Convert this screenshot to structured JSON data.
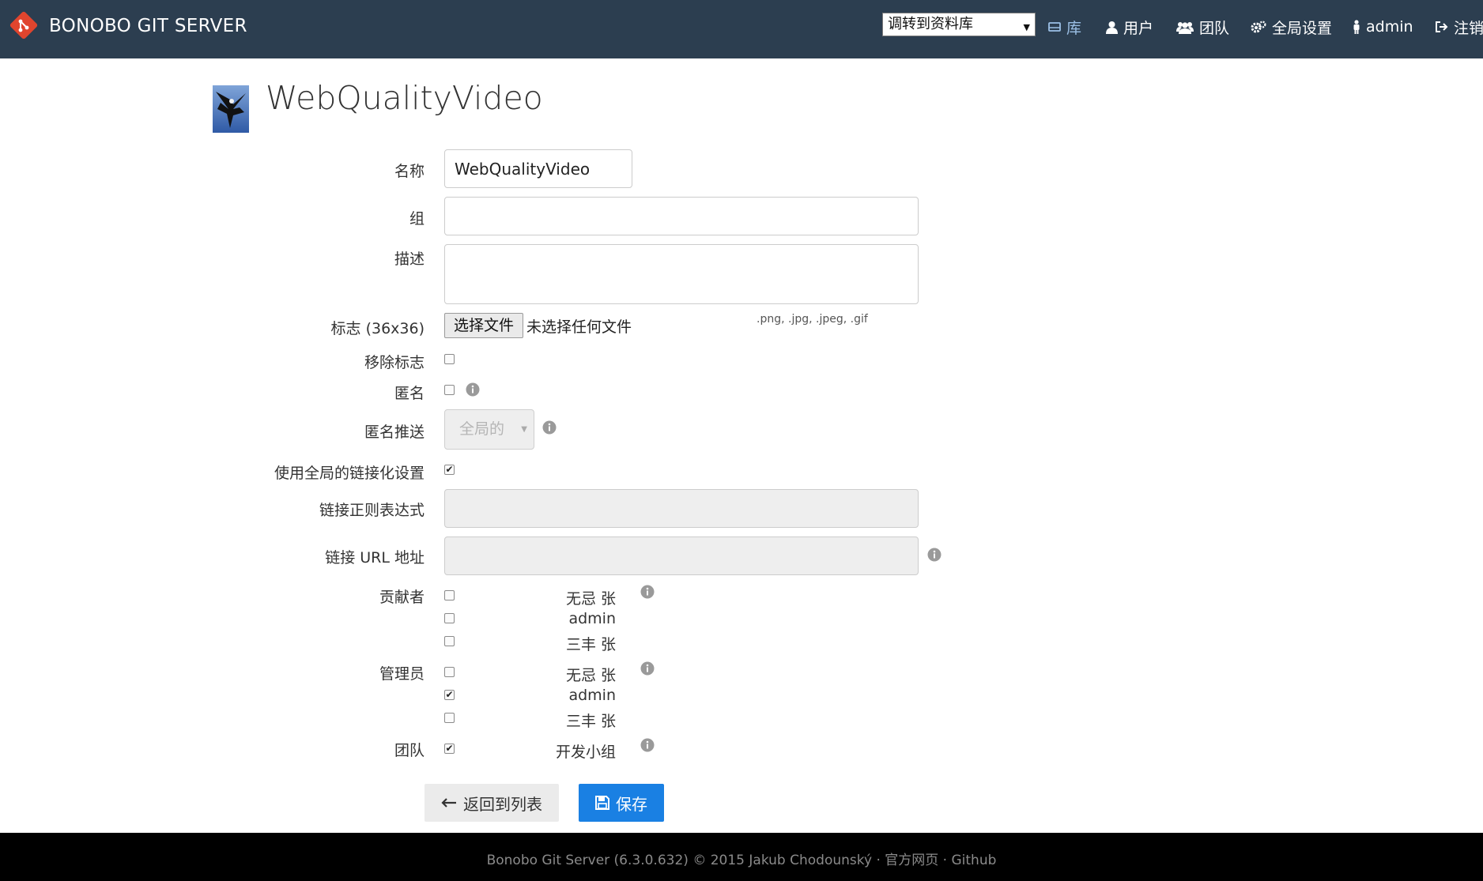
{
  "navbar": {
    "brand": "BONOBO GIT SERVER",
    "repo_jump": "调转到资料库",
    "items": [
      {
        "label": "库",
        "icon": "repository-icon",
        "active": true
      },
      {
        "label": "用户",
        "icon": "user-icon"
      },
      {
        "label": "团队",
        "icon": "team-icon"
      },
      {
        "label": "全局设置",
        "icon": "gears-icon"
      },
      {
        "label": "admin",
        "icon": "person-icon"
      },
      {
        "label": "注销",
        "icon": "logout-icon"
      }
    ]
  },
  "page": {
    "title": "WebQualityVideo"
  },
  "form": {
    "name_label": "名称",
    "name_value": "WebQualityVideo",
    "group_label": "组",
    "group_value": "",
    "description_label": "描述",
    "description_value": "",
    "logo_label": "标志 (36x36)",
    "choose_file": "选择文件",
    "no_file": "未选择任何文件",
    "file_types": ".png, .jpg, .jpeg, .gif",
    "remove_logo_label": "移除标志",
    "remove_logo_checked": false,
    "anonymous_label": "匿名",
    "anonymous_checked": false,
    "anonymous_push_label": "匿名推送",
    "anonymous_push_value": "全局的",
    "global_linkify_label": "使用全局的链接化设置",
    "global_linkify_checked": true,
    "link_regex_label": "链接正则表达式",
    "link_regex_value": "",
    "link_url_label": "链接 URL 地址",
    "link_url_value": "",
    "contributors_label": "贡献者",
    "contributors": [
      {
        "name": "无忌 张",
        "checked": false
      },
      {
        "name": "admin",
        "checked": false
      },
      {
        "name": "三丰 张",
        "checked": false
      }
    ],
    "administrators_label": "管理员",
    "administrators": [
      {
        "name": "无忌 张",
        "checked": false
      },
      {
        "name": "admin",
        "checked": true
      },
      {
        "name": "三丰 张",
        "checked": false
      }
    ],
    "teams_label": "团队",
    "teams": [
      {
        "name": "开发小组",
        "checked": true
      }
    ],
    "back_button": "返回到列表",
    "save_button": "保存"
  },
  "footer": {
    "text": "Bonobo Git Server (6.3.0.632) © 2015 Jakub Chodounský",
    "sep": " · ",
    "homepage": "官方网页",
    "github": "Github"
  },
  "colors": {
    "navbar_bg": "#2c3e50",
    "primary": "#1a80e3",
    "footer_bg": "#000000"
  }
}
